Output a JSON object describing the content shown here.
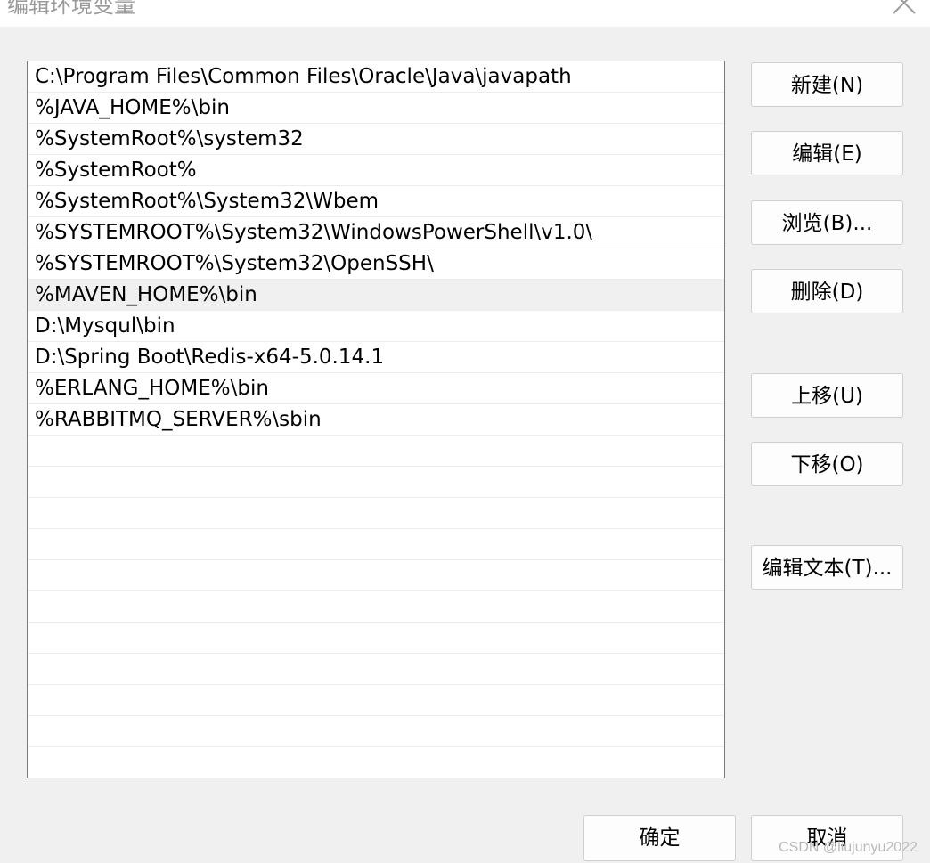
{
  "window": {
    "title": "编辑环境变量",
    "close_icon": "close-icon"
  },
  "path_entries": [
    "C:\\Program Files\\Common Files\\Oracle\\Java\\javapath",
    "%JAVA_HOME%\\bin",
    "%SystemRoot%\\system32",
    "%SystemRoot%",
    "%SystemRoot%\\System32\\Wbem",
    "%SYSTEMROOT%\\System32\\WindowsPowerShell\\v1.0\\",
    "%SYSTEMROOT%\\System32\\OpenSSH\\",
    "%MAVEN_HOME%\\bin",
    "D:\\Mysqul\\bin",
    "D:\\Spring Boot\\Redis-x64-5.0.14.1",
    "%ERLANG_HOME%\\bin",
    "%RABBITMQ_SERVER%\\sbin"
  ],
  "selected_entry": "%MAVEN_HOME%\\bin",
  "buttons": {
    "new": "新建(N)",
    "edit": "编辑(E)",
    "browse": "浏览(B)...",
    "delete": "删除(D)",
    "move_up": "上移(U)",
    "move_down": "下移(O)",
    "edit_text": "编辑文本(T)...",
    "ok": "确定",
    "cancel": "取消"
  },
  "watermark": "CSDN @liujunyu2022",
  "colors": {
    "dialog_bg": "#f0f0f0",
    "list_bg": "#ffffff",
    "selected_row": "#f0f0f0"
  }
}
